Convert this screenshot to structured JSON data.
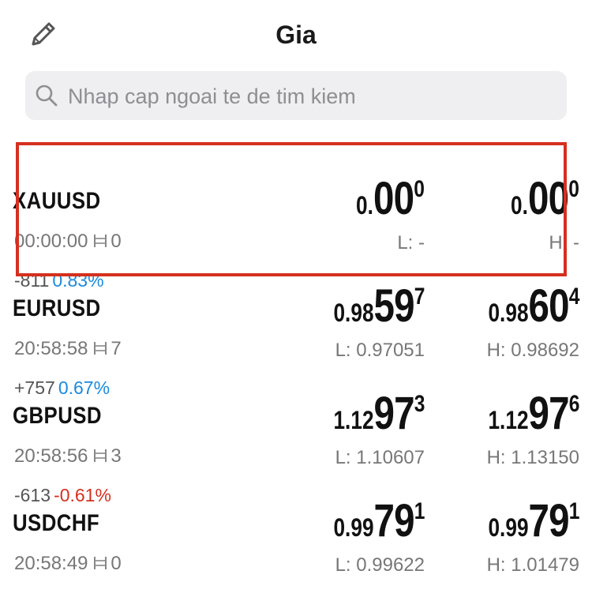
{
  "header": {
    "title": "Gia"
  },
  "search": {
    "placeholder": "Nhap cap ngoai te de tim kiem",
    "value": ""
  },
  "quotes": [
    {
      "change_points": "",
      "change_pct": "",
      "symbol": "XAUUSD",
      "time": "00:00:00",
      "spread": "0",
      "bid": {
        "small": "0.",
        "big": "00",
        "sup": "0"
      },
      "ask": {
        "small": "0.",
        "big": "00",
        "sup": "0"
      },
      "low": "L: -",
      "high": "H: -"
    },
    {
      "change_points": "-811",
      "change_pct": "0.83%",
      "symbol": "EURUSD",
      "time": "20:58:58",
      "spread": "7",
      "bid": {
        "small": "0.98",
        "big": "59",
        "sup": "7"
      },
      "ask": {
        "small": "0.98",
        "big": "60",
        "sup": "4"
      },
      "low": "L: 0.97051",
      "high": "H: 0.98692"
    },
    {
      "change_points": "+757",
      "change_pct": "0.67%",
      "symbol": "GBPUSD",
      "time": "20:58:56",
      "spread": "3",
      "bid": {
        "small": "1.12",
        "big": "97",
        "sup": "3"
      },
      "ask": {
        "small": "1.12",
        "big": "97",
        "sup": "6"
      },
      "low": "L: 1.10607",
      "high": "H: 1.13150"
    },
    {
      "change_points": "-613",
      "change_pct": "-0.61%",
      "symbol": "USDCHF",
      "time": "20:58:49",
      "spread": "0",
      "bid": {
        "small": "0.99",
        "big": "79",
        "sup": "1"
      },
      "ask": {
        "small": "0.99",
        "big": "79",
        "sup": "1"
      },
      "low": "L: 0.99622",
      "high": "H: 1.01479"
    }
  ],
  "colors": {
    "positive": "#1a8ae0",
    "negative": "#d5301f",
    "highlight_border": "#d5301f"
  }
}
